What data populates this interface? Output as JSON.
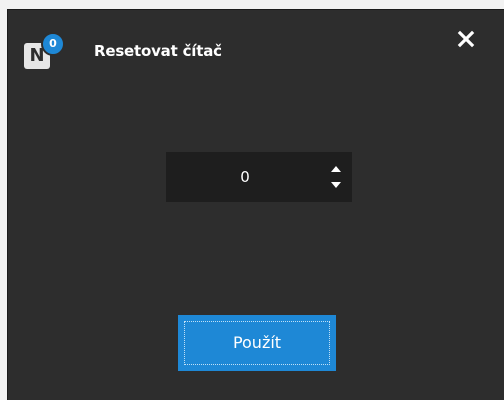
{
  "dialog": {
    "title": "Resetovat čítač",
    "app_icon": {
      "letter": "N",
      "badge_count": "0",
      "badge_color": "#1e88d6"
    },
    "close_icon": "close-icon"
  },
  "counter": {
    "value": "0",
    "up_icon": "caret-up-icon",
    "down_icon": "caret-down-icon"
  },
  "apply_button": {
    "label": "Použít",
    "color": "#1e88d6"
  },
  "colors": {
    "background": "#2d2d2d",
    "input_background": "#1e1e1e",
    "accent": "#1e88d6"
  }
}
